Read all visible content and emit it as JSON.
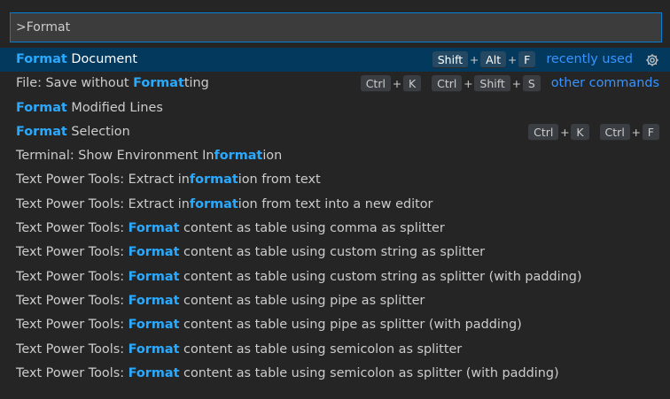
{
  "input": {
    "value": ">Format"
  },
  "rows": [
    {
      "parts": [
        {
          "t": "Format",
          "h": true
        },
        {
          "t": " Document",
          "h": false
        }
      ],
      "keybindings": [
        [
          "Shift",
          "Alt",
          "F"
        ]
      ],
      "meta": "recently used",
      "gear": true,
      "selected": true
    },
    {
      "parts": [
        {
          "t": "File: Save without ",
          "h": false
        },
        {
          "t": "Format",
          "h": true
        },
        {
          "t": "ting",
          "h": false
        }
      ],
      "keybindings": [
        [
          "Ctrl",
          "K"
        ],
        [
          "Ctrl",
          "Shift",
          "S"
        ]
      ],
      "meta": "other commands",
      "gear": false,
      "selected": false
    },
    {
      "parts": [
        {
          "t": "Format",
          "h": true
        },
        {
          "t": " Modified Lines",
          "h": false
        }
      ],
      "keybindings": [],
      "meta": "",
      "gear": false,
      "selected": false
    },
    {
      "parts": [
        {
          "t": "Format",
          "h": true
        },
        {
          "t": " Selection",
          "h": false
        }
      ],
      "keybindings": [
        [
          "Ctrl",
          "K"
        ],
        [
          "Ctrl",
          "F"
        ]
      ],
      "meta": "",
      "gear": false,
      "selected": false
    },
    {
      "parts": [
        {
          "t": "Terminal: Show Environment In",
          "h": false
        },
        {
          "t": "format",
          "h": true
        },
        {
          "t": "ion",
          "h": false
        }
      ],
      "keybindings": [],
      "meta": "",
      "gear": false,
      "selected": false
    },
    {
      "parts": [
        {
          "t": "Text Power Tools: Extract in",
          "h": false
        },
        {
          "t": "format",
          "h": true
        },
        {
          "t": "ion from text",
          "h": false
        }
      ],
      "keybindings": [],
      "meta": "",
      "gear": false,
      "selected": false
    },
    {
      "parts": [
        {
          "t": "Text Power Tools: Extract in",
          "h": false
        },
        {
          "t": "format",
          "h": true
        },
        {
          "t": "ion from text into a new editor",
          "h": false
        }
      ],
      "keybindings": [],
      "meta": "",
      "gear": false,
      "selected": false
    },
    {
      "parts": [
        {
          "t": "Text Power Tools: ",
          "h": false
        },
        {
          "t": "Format",
          "h": true
        },
        {
          "t": " content as table using comma as splitter",
          "h": false
        }
      ],
      "keybindings": [],
      "meta": "",
      "gear": false,
      "selected": false
    },
    {
      "parts": [
        {
          "t": "Text Power Tools: ",
          "h": false
        },
        {
          "t": "Format",
          "h": true
        },
        {
          "t": " content as table using custom string as splitter",
          "h": false
        }
      ],
      "keybindings": [],
      "meta": "",
      "gear": false,
      "selected": false
    },
    {
      "parts": [
        {
          "t": "Text Power Tools: ",
          "h": false
        },
        {
          "t": "Format",
          "h": true
        },
        {
          "t": " content as table using custom string as splitter (with padding)",
          "h": false
        }
      ],
      "keybindings": [],
      "meta": "",
      "gear": false,
      "selected": false
    },
    {
      "parts": [
        {
          "t": "Text Power Tools: ",
          "h": false
        },
        {
          "t": "Format",
          "h": true
        },
        {
          "t": " content as table using pipe as splitter",
          "h": false
        }
      ],
      "keybindings": [],
      "meta": "",
      "gear": false,
      "selected": false
    },
    {
      "parts": [
        {
          "t": "Text Power Tools: ",
          "h": false
        },
        {
          "t": "Format",
          "h": true
        },
        {
          "t": " content as table using pipe as splitter (with padding)",
          "h": false
        }
      ],
      "keybindings": [],
      "meta": "",
      "gear": false,
      "selected": false
    },
    {
      "parts": [
        {
          "t": "Text Power Tools: ",
          "h": false
        },
        {
          "t": "Format",
          "h": true
        },
        {
          "t": " content as table using semicolon as splitter",
          "h": false
        }
      ],
      "keybindings": [],
      "meta": "",
      "gear": false,
      "selected": false
    },
    {
      "parts": [
        {
          "t": "Text Power Tools: ",
          "h": false
        },
        {
          "t": "Format",
          "h": true
        },
        {
          "t": " content as table using semicolon as splitter (with padding)",
          "h": false
        }
      ],
      "keybindings": [],
      "meta": "",
      "gear": false,
      "selected": false
    }
  ],
  "icons": {
    "gear": "gear-icon"
  },
  "colors": {
    "background": "#252526",
    "input_background": "#3c3c3c",
    "focus_border": "#007fd4",
    "selected_row": "#04395e",
    "highlight": "#2aaaff",
    "meta_link": "#3794ff",
    "text": "#cccccc"
  }
}
